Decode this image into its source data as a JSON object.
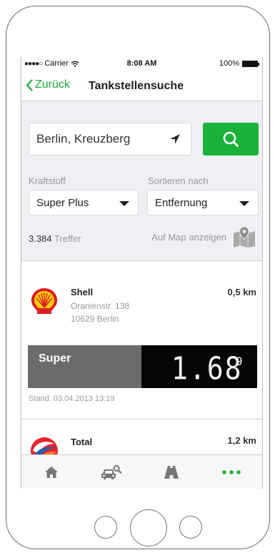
{
  "status_bar": {
    "signal": "●●●●○",
    "carrier": "Carrier",
    "time": "8:08 AM",
    "battery": "100%"
  },
  "navbar": {
    "back_label": "Zurück",
    "title": "Tankstellensuche"
  },
  "search": {
    "location_value": "Berlin, Kreuzberg"
  },
  "filters": {
    "fuel_label": "Kraftstoff",
    "fuel_value": "Super Plus",
    "sort_label": "Sortieren nach",
    "sort_value": "Entfernung"
  },
  "results": {
    "count": "3.384",
    "count_unit": "Treffer",
    "map_link": "Auf Map anzeigen"
  },
  "stations": [
    {
      "name": "Shell",
      "street": "Oranienstr. 138",
      "city": "10629 Berlin",
      "distance": "0,5 km",
      "fuel": "Super",
      "price": "1.68",
      "price_fraction": "9",
      "updated": "Stand: 03.04.2013 13:19"
    },
    {
      "name": "Total",
      "distance": "1,2 km"
    }
  ],
  "tabbar": {
    "tabs": [
      "home-icon",
      "car-search-icon",
      "road-icon",
      "more-icon"
    ],
    "active_color": "#1ab23a"
  },
  "colors": {
    "accent": "#1ab23a",
    "price_label_bg": "#6b6b6b",
    "price_value_bg": "#050505"
  }
}
